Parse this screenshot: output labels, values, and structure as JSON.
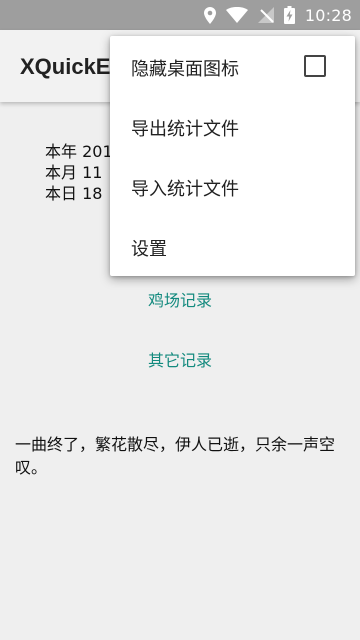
{
  "status_bar": {
    "time": "10:28",
    "icons": [
      "location-icon",
      "wifi-icon",
      "signal-off-icon",
      "battery-charging-icon"
    ]
  },
  "app_bar": {
    "title": "XQuickE"
  },
  "stats": {
    "year": "本年 201",
    "month": "本月 11",
    "day": "本日 18"
  },
  "links": {
    "chicken": "鸡场记录",
    "other": "其它记录"
  },
  "quote": "一曲终了，繁花散尽，伊人已逝，只余一声空叹。",
  "menu": {
    "items": [
      {
        "label": "隐藏桌面图标",
        "checkbox": true,
        "checked": false
      },
      {
        "label": "导出统计文件"
      },
      {
        "label": "导入统计文件"
      },
      {
        "label": "设置"
      }
    ]
  },
  "colors": {
    "status_bar": "#9e9e9e",
    "accent": "#138a7e",
    "background": "#efefef"
  }
}
